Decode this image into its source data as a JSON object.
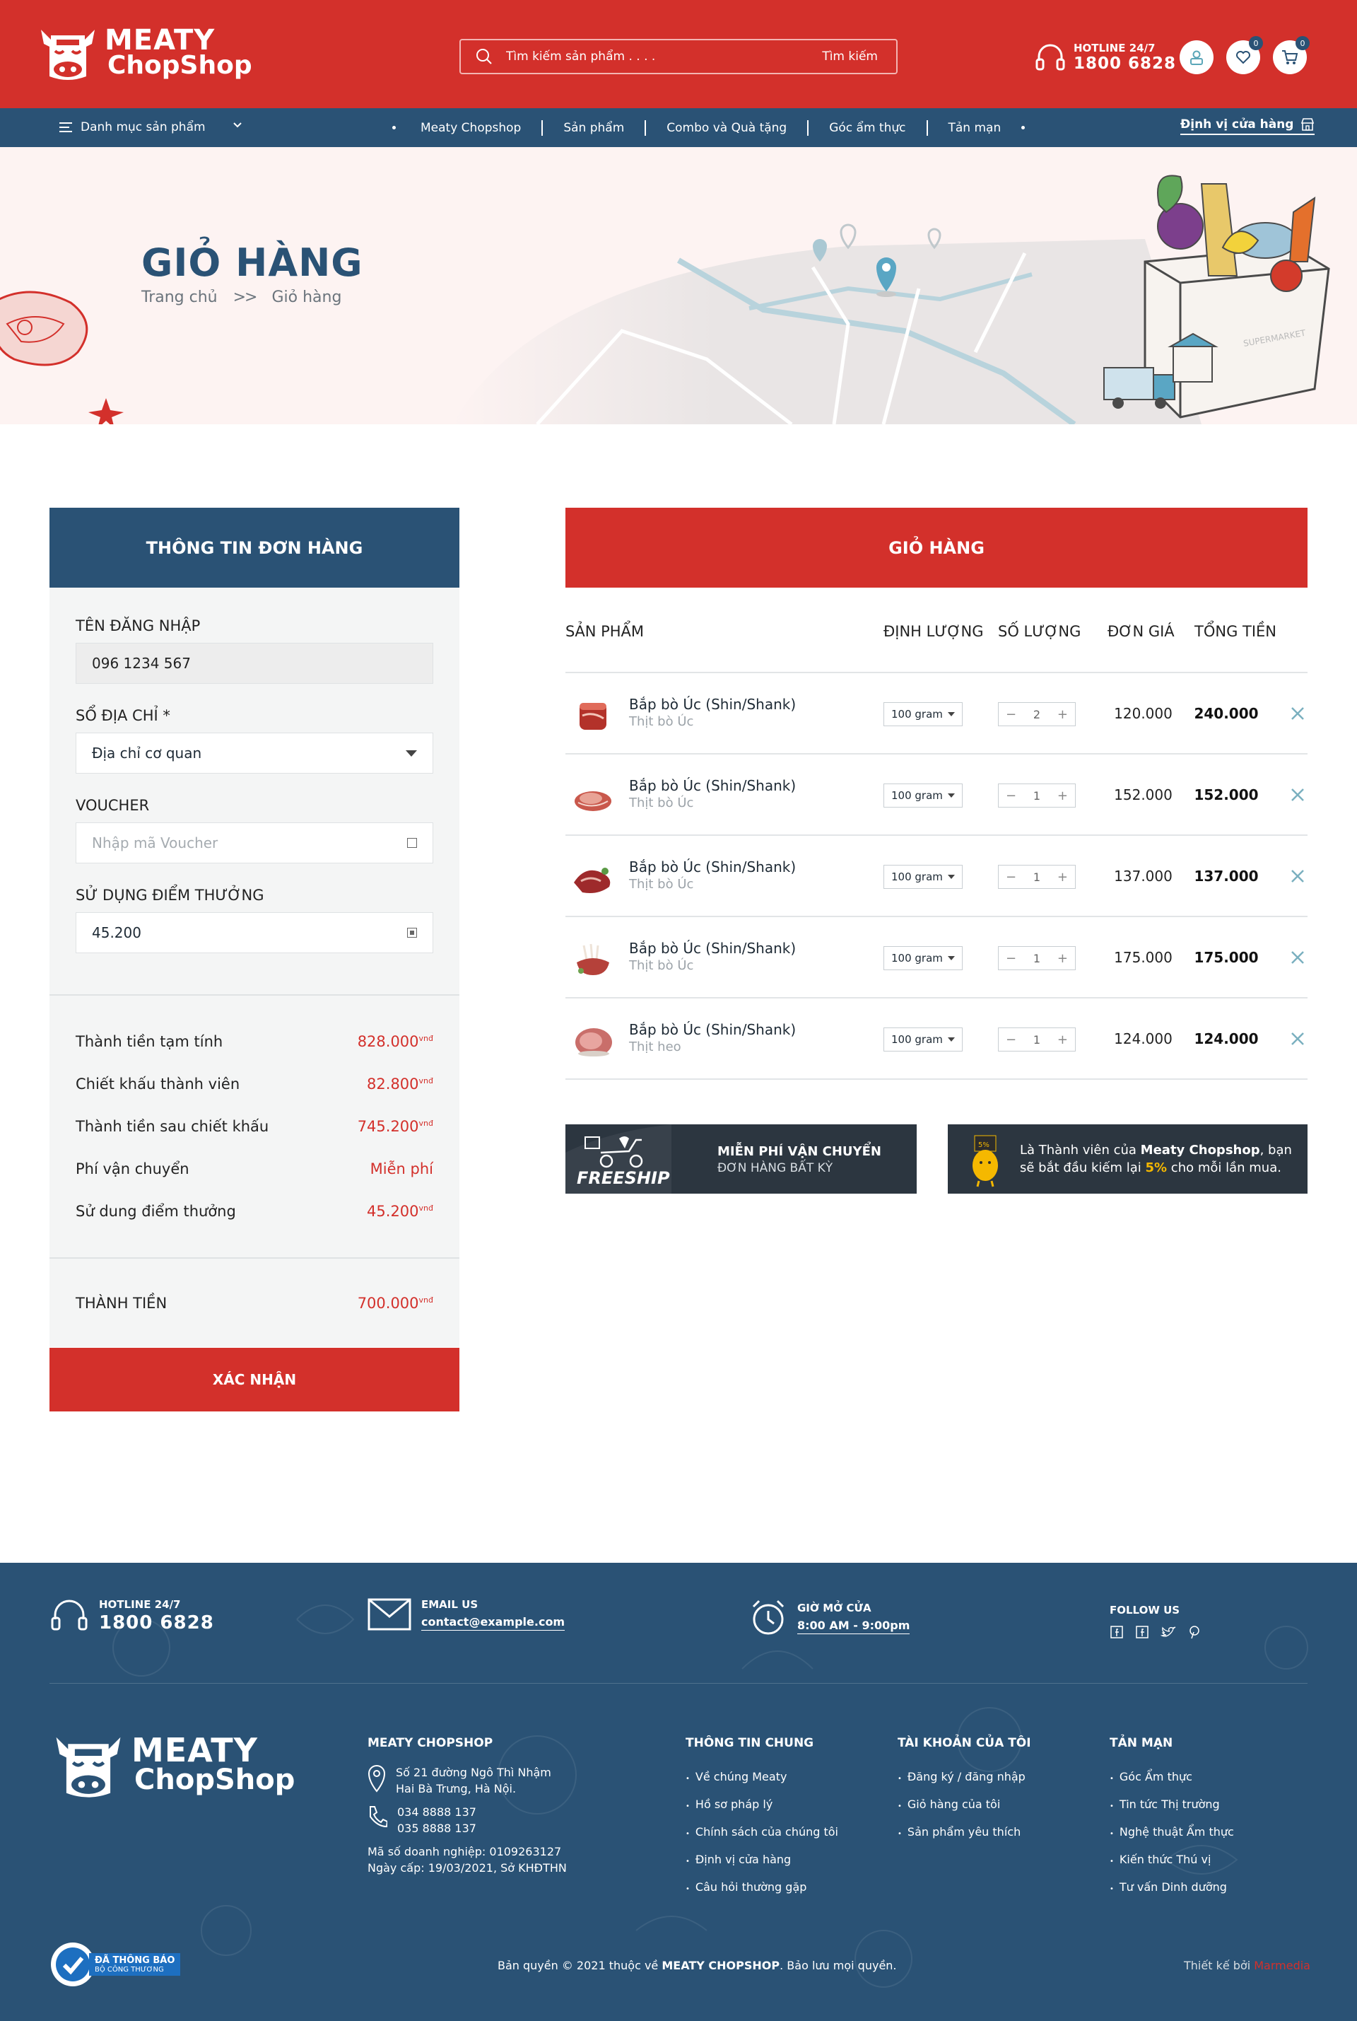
{
  "header": {
    "logo_line1": "MEATY",
    "logo_line2": "ChopShop",
    "search_placeholder": "Tìm kiếm sản phẩm . . . .",
    "search_button": "Tìm kiếm",
    "hotline_label": "HOTLINE 24/7",
    "hotline_number": "1800 6828",
    "wishlist_count": "0",
    "cart_count": "0"
  },
  "nav": {
    "category_label": "Danh mục sản phẩm",
    "menu": [
      "Meaty Chopshop",
      "Sản phẩm",
      "Combo và Quà tặng",
      "Góc ẩm thực",
      "Tản mạn"
    ],
    "store_locator": "Định vị cửa hàng"
  },
  "banner": {
    "title": "GIỎ HÀNG",
    "breadcrumb_home": "Trang chủ",
    "breadcrumb_sep": ">>",
    "breadcrumb_current": "Giỏ hàng",
    "box_text": "SUPERMARKET"
  },
  "order": {
    "title": "THÔNG TIN ĐƠN HÀNG",
    "username_label": "TÊN ĐĂNG NHẬP",
    "username_value": "096 1234 567",
    "address_label": "SỔ ĐỊA CHỈ *",
    "address_value": "Địa chỉ cơ quan",
    "voucher_label": "VOUCHER",
    "voucher_placeholder": "Nhập mã Voucher",
    "points_label": "SỬ DỤNG ĐIỂM THƯỞNG",
    "points_value": "45.200",
    "summary": [
      {
        "label": "Thành tiền tạm tính",
        "value": "828.000",
        "unit": "vnđ"
      },
      {
        "label": "Chiết khấu thành viên",
        "value": "82.800",
        "unit": "vnđ"
      },
      {
        "label": "Thành tiền sau chiết khấu",
        "value": "745.200",
        "unit": "vnđ"
      },
      {
        "label": "Phí vận chuyển",
        "value": "Miễn phí",
        "unit": ""
      },
      {
        "label": "Sử dung điểm thưởng",
        "value": "45.200",
        "unit": "vnđ"
      }
    ],
    "total_label": "THÀNH TIỀN",
    "total_value": "700.000",
    "total_unit": "vnđ",
    "confirm_button": "XÁC NHẬN"
  },
  "cart": {
    "title": "GIỎ HÀNG",
    "columns": [
      "SẢN PHẨM",
      "ĐỊNH LƯỢNG",
      "SỐ LƯỢNG",
      "ĐƠN GIÁ",
      "TỔNG TIỀN"
    ],
    "items": [
      {
        "name": "Bắp bò Úc (Shin/Shank)",
        "sub": "Thịt bò Úc",
        "unit": "100 gram",
        "qty": "2",
        "price": "120.000",
        "total": "240.000"
      },
      {
        "name": "Bắp bò Úc (Shin/Shank)",
        "sub": "Thịt bò Úc",
        "unit": "100 gram",
        "qty": "1",
        "price": "152.000",
        "total": "152.000"
      },
      {
        "name": "Bắp bò Úc (Shin/Shank)",
        "sub": "Thịt bò Úc",
        "unit": "100 gram",
        "qty": "1",
        "price": "137.000",
        "total": "137.000"
      },
      {
        "name": "Bắp bò Úc (Shin/Shank)",
        "sub": "Thịt bò Úc",
        "unit": "100 gram",
        "qty": "1",
        "price": "175.000",
        "total": "175.000"
      },
      {
        "name": "Bắp bò Úc (Shin/Shank)",
        "sub": "Thịt heo",
        "unit": "100 gram",
        "qty": "1",
        "price": "124.000",
        "total": "124.000"
      }
    ],
    "qty_minus": "−",
    "qty_plus": "+"
  },
  "promo": {
    "freeship_tag": "FREESHIP",
    "ship_title": "MIỄN PHÍ VẬN CHUYỂN",
    "ship_sub": "ĐƠN HÀNG BẤT KỲ",
    "member_pre": "Là Thành viên của ",
    "member_brand": "Meaty Chopshop",
    "member_mid": ", bạn sẽ bắt đầu kiếm lại ",
    "member_pct": "5%",
    "member_post": " cho mỗi lần mua.",
    "badge_pct": "5%"
  },
  "footer": {
    "hotline_label": "HOTLINE 24/7",
    "hotline_number": "1800 6828",
    "email_label": "EMAIL US",
    "email_value": "contact@example.com",
    "hours_label": "GIỜ MỞ CỬA",
    "hours_value": "8:00 AM  -  9:00pm",
    "follow_label": "FOLLOW US",
    "company_title": "MEATY CHOPSHOP",
    "address_line1": "Số 21 đường Ngô Thì Nhậm",
    "address_line2": "Hai Bà Trưng, Hà Nội.",
    "phone1": "034 8888 137",
    "phone2": "035 8888 137",
    "business_no": "Mã số doanh nghiệp: 0109263127",
    "issue_date": "Ngày cấp: 19/03/2021, Sở KHĐTHN",
    "col_info_title": "THÔNG TIN CHUNG",
    "col_info_links": [
      "Về chúng Meaty",
      "Hồ sơ pháp lý",
      "Chính sách của chúng tôi",
      "Định vị cửa hàng",
      "Câu hỏi thường gặp"
    ],
    "col_account_title": "TÀI KHOẢN CỦA TÔI",
    "col_account_links": [
      "Đăng ký / đăng nhập",
      "Giỏ hàng của tôi",
      "Sản phẩm yêu thích"
    ],
    "col_misc_title": "TẢN MẠN",
    "col_misc_links": [
      "Góc Ẩm thực",
      "Tin tức Thị trường",
      "Nghệ thuật Ẩm thực",
      "Kiến thức Thú vị",
      "Tư vấn Dinh dưỡng"
    ],
    "badge_line1": "ĐÃ THÔNG BÁO",
    "badge_line2": "BỘ CÔNG THƯƠNG",
    "copyright_pre": "Bản quyền © 2021 thuộc về ",
    "copyright_brand": "MEATY CHOPSHOP",
    "copyright_post": ". Bảo lưu mọi quyền.",
    "design_label": "Thiết kế bởi ",
    "design_brand": "Marmedia"
  },
  "colors": {
    "primary_red": "#d3302b",
    "navy": "#2a5275",
    "dark_promo": "#2c3640",
    "accent_yellow": "#f5b800"
  }
}
